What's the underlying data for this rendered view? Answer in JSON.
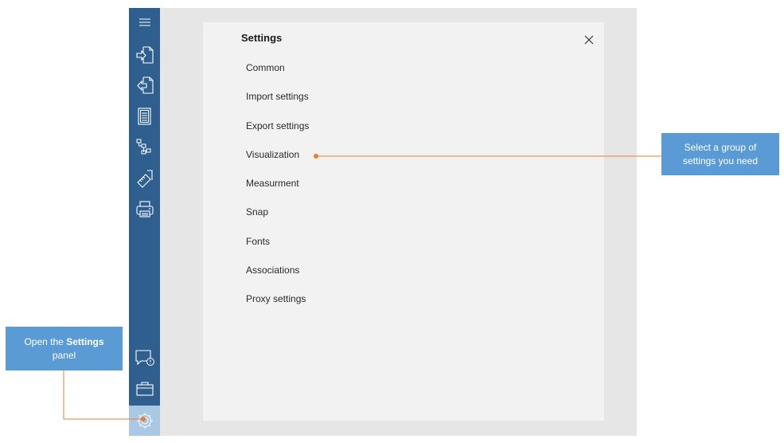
{
  "sidebar": {
    "items": [
      {
        "icon": "menu-icon"
      },
      {
        "icon": "import-icon"
      },
      {
        "icon": "export-icon"
      },
      {
        "icon": "document-icon"
      },
      {
        "icon": "tree-structure-icon"
      },
      {
        "icon": "measure-tool-icon"
      },
      {
        "icon": "print-icon"
      }
    ],
    "bottom_items": [
      {
        "icon": "feedback-icon"
      },
      {
        "icon": "briefcase-icon"
      },
      {
        "icon": "settings-gear-icon",
        "active": true
      }
    ]
  },
  "panel": {
    "title": "Settings",
    "close_icon": "close-icon",
    "items": [
      "Common",
      "Import settings",
      "Export settings",
      "Visualization",
      "Measurment",
      "Snap",
      "Fonts",
      "Associations",
      "Proxy settings"
    ]
  },
  "callouts": {
    "right": {
      "line1": "Select a group of",
      "line2": "settings you need"
    },
    "left": {
      "prefix": "Open the ",
      "bold": "Settings",
      "line2": "panel"
    }
  },
  "colors": {
    "sidebar": "#2f5f8f",
    "callout": "#5b9bd5",
    "connector": "#ed7d31",
    "active_item": "#a9c8e4"
  }
}
